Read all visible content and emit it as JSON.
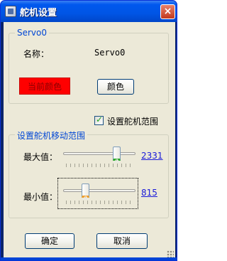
{
  "window": {
    "title": "舵机设置",
    "close_glyph": "×"
  },
  "servo_group": {
    "label": "Servo0",
    "name_label": "名称：",
    "name_value": "Servo0",
    "current_color_label": "当前颜色",
    "current_color": "#ff0000",
    "color_button": "颜色"
  },
  "range_checkbox": {
    "label": "设置舵机范围",
    "checked": true
  },
  "range_group": {
    "label": "设置舵机移动范围",
    "max_label": "最大值：",
    "max_value": "2331",
    "min_label": "最小值：",
    "min_value": "815"
  },
  "buttons": {
    "ok": "确定",
    "cancel": "取消"
  }
}
